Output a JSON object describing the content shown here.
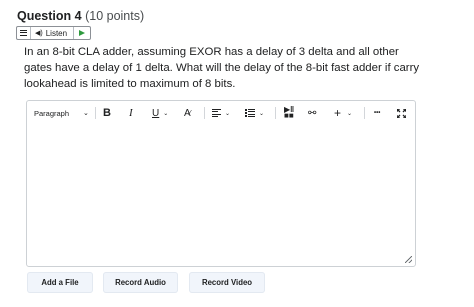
{
  "question": {
    "number_label": "Question 4",
    "points_label": "(10 points)",
    "text": "In an 8-bit CLA adder, assuming EXOR has a delay of 3 delta and all other gates have a delay of 1 delta. What will the delay of the 8-bit fast adder if carry lookahead is limited to maximum of 8 bits."
  },
  "listen": {
    "label": "Listen",
    "icons": [
      "menu-icon",
      "speaker-icon",
      "play-icon"
    ],
    "play_color": "#2e9a3e"
  },
  "toolbar": {
    "format_select": "Paragraph",
    "bold": "B",
    "italic": "I",
    "underline": "U",
    "font": "A",
    "icons": [
      "chevron-down-icon",
      "align-icon",
      "list-icon",
      "insert-stuff-icon",
      "link-icon",
      "plus-icon",
      "more-icon",
      "fullscreen-icon"
    ],
    "plus": "+",
    "more": "•••"
  },
  "editor": {
    "content": ""
  },
  "actions": {
    "add_file": "Add a File",
    "record_audio": "Record Audio",
    "record_video": "Record Video"
  }
}
